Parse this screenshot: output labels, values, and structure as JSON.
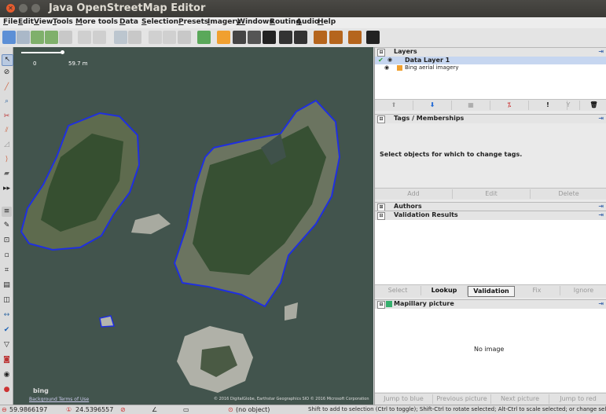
{
  "window": {
    "title": "Java OpenStreetMap Editor"
  },
  "menu": [
    "File",
    "Edit",
    "View",
    "Tools",
    "More tools",
    "Data",
    "Selection",
    "Presets",
    "Imagery",
    "Windows",
    "Routing",
    "Audio",
    "Help"
  ],
  "scale": {
    "start": "0",
    "end": "59.7 m"
  },
  "map": {
    "attribution_left": "Background Terms of Use",
    "attribution_right": "© 2016 DigitalGlobe, Earthstar Geographics SIO © 2016 Microsoft Corporation",
    "bing_logo": "bing"
  },
  "layers": {
    "title": "Layers",
    "items": [
      {
        "name": "Data Layer 1",
        "active": true
      },
      {
        "name": "Bing aerial imagery",
        "active": false
      }
    ]
  },
  "tags": {
    "title": "Tags / Memberships",
    "message": "Select objects for which to change tags.",
    "buttons": [
      "Add",
      "Edit",
      "Delete"
    ]
  },
  "authors": {
    "title": "Authors"
  },
  "validation": {
    "title": "Validation Results",
    "buttons": [
      "Select",
      "Lookup",
      "Validation",
      "Fix",
      "Ignore"
    ]
  },
  "mapillary": {
    "title": "Mapillary picture",
    "message": "No image",
    "buttons": [
      "Jump to blue",
      "Previous picture",
      "Next picture",
      "Jump to red"
    ]
  },
  "status": {
    "lat": "59.9866197",
    "lon": "24.5396557",
    "object": "(no object)",
    "help": "Shift to add to selection (Ctrl to toggle); Shift-Ctrl to rotate selected; Alt-Ctrl to scale selected; or change selectio"
  },
  "colors": {
    "way": "#1f2fe0",
    "water": "#3f514a",
    "selected_layer": "#c6d6f0"
  }
}
